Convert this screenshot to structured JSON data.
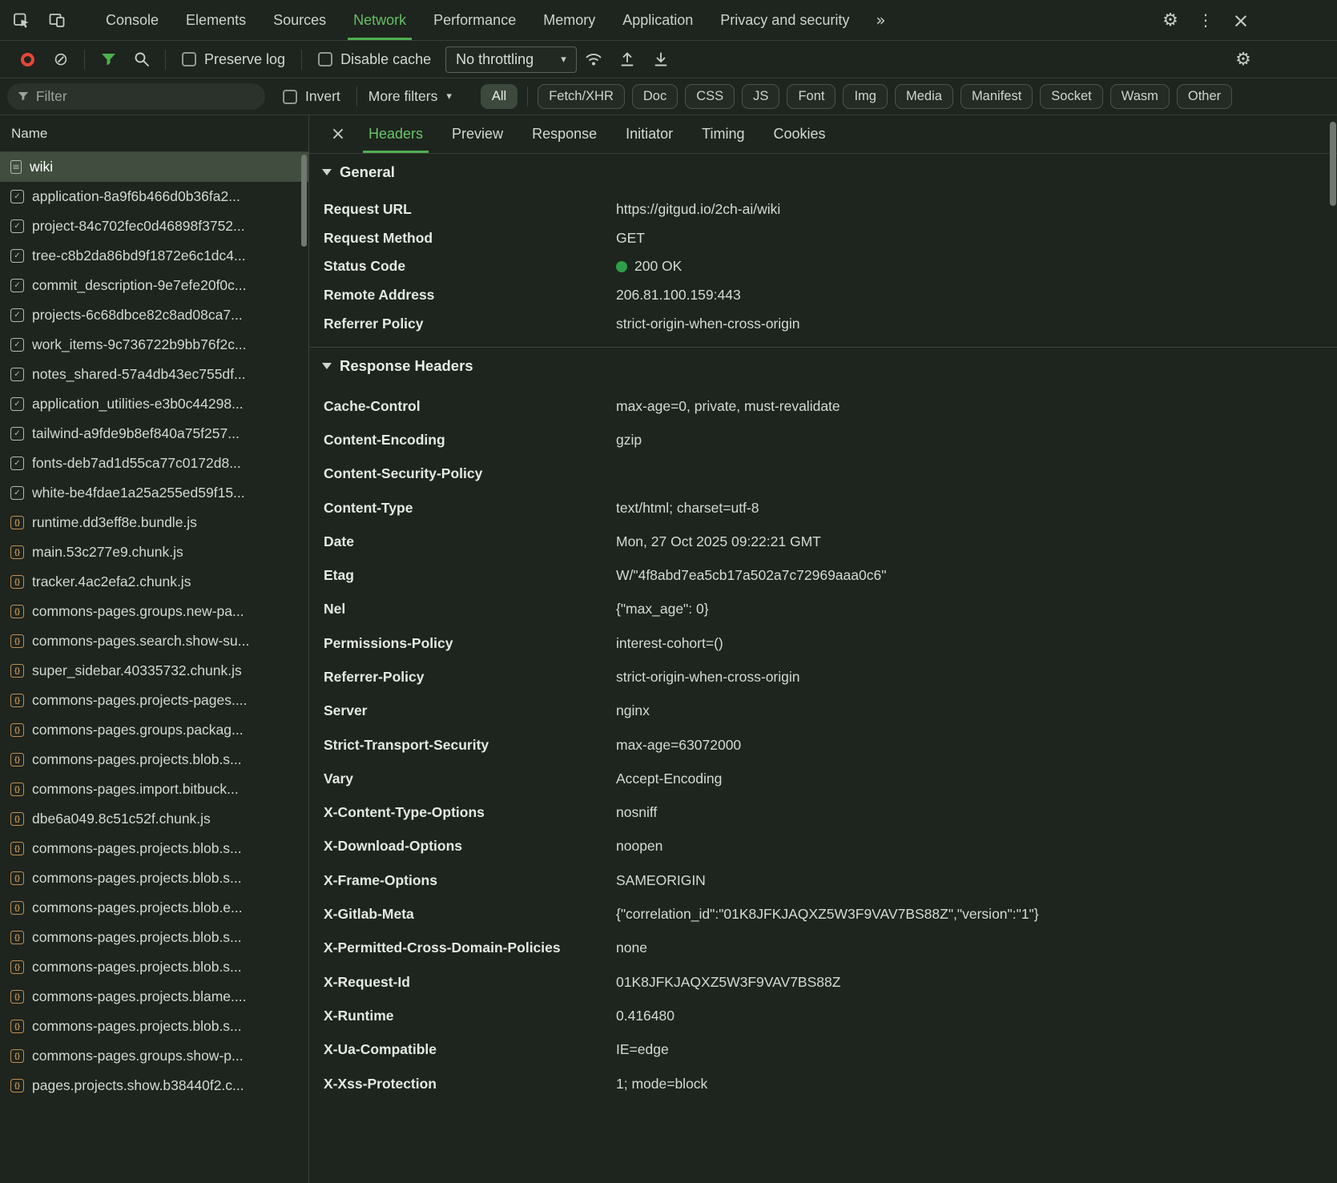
{
  "icons": {
    "more_tabs": "»",
    "gear": "⚙",
    "kebab": "⋮",
    "close": "×",
    "clear": "⊘",
    "caret": "▾"
  },
  "devtools": {
    "tabs": [
      {
        "label": "Console",
        "active": false
      },
      {
        "label": "Elements",
        "active": false
      },
      {
        "label": "Sources",
        "active": false
      },
      {
        "label": "Network",
        "active": true
      },
      {
        "label": "Performance",
        "active": false
      },
      {
        "label": "Memory",
        "active": false
      },
      {
        "label": "Application",
        "active": false
      },
      {
        "label": "Privacy and security",
        "active": false
      }
    ]
  },
  "toolbar": {
    "preserve_log_label": "Preserve log",
    "disable_cache_label": "Disable cache",
    "throttling_value": "No throttling"
  },
  "filter_bar": {
    "filter_placeholder": "Filter",
    "invert_label": "Invert",
    "more_filters_label": "More filters",
    "selected_chip": "All",
    "chips": [
      "All",
      "Fetch/XHR",
      "Doc",
      "CSS",
      "JS",
      "Font",
      "Img",
      "Media",
      "Manifest",
      "Socket",
      "Wasm",
      "Other"
    ]
  },
  "request_list": {
    "column_header": "Name",
    "items": [
      {
        "name": "wiki",
        "type": "doc",
        "selected": true
      },
      {
        "name": "application-8a9f6b466d0b36fa2...",
        "type": "css"
      },
      {
        "name": "project-84c702fec0d46898f3752...",
        "type": "css"
      },
      {
        "name": "tree-c8b2da86bd9f1872e6c1dc4...",
        "type": "css"
      },
      {
        "name": "commit_description-9e7efe20f0c...",
        "type": "css"
      },
      {
        "name": "projects-6c68dbce82c8ad08ca7...",
        "type": "css"
      },
      {
        "name": "work_items-9c736722b9bb76f2c...",
        "type": "css"
      },
      {
        "name": "notes_shared-57a4db43ec755df...",
        "type": "css"
      },
      {
        "name": "application_utilities-e3b0c44298...",
        "type": "css"
      },
      {
        "name": "tailwind-a9fde9b8ef840a75f257...",
        "type": "css"
      },
      {
        "name": "fonts-deb7ad1d55ca77c0172d8...",
        "type": "css"
      },
      {
        "name": "white-be4fdae1a25a255ed59f15...",
        "type": "css"
      },
      {
        "name": "runtime.dd3eff8e.bundle.js",
        "type": "js"
      },
      {
        "name": "main.53c277e9.chunk.js",
        "type": "js"
      },
      {
        "name": "tracker.4ac2efa2.chunk.js",
        "type": "js"
      },
      {
        "name": "commons-pages.groups.new-pa...",
        "type": "js"
      },
      {
        "name": "commons-pages.search.show-su...",
        "type": "js"
      },
      {
        "name": "super_sidebar.40335732.chunk.js",
        "type": "js"
      },
      {
        "name": "commons-pages.projects-pages....",
        "type": "js"
      },
      {
        "name": "commons-pages.groups.packag...",
        "type": "js"
      },
      {
        "name": "commons-pages.projects.blob.s...",
        "type": "js"
      },
      {
        "name": "commons-pages.import.bitbuck...",
        "type": "js"
      },
      {
        "name": "dbe6a049.8c51c52f.chunk.js",
        "type": "js"
      },
      {
        "name": "commons-pages.projects.blob.s...",
        "type": "js"
      },
      {
        "name": "commons-pages.projects.blob.s...",
        "type": "js"
      },
      {
        "name": "commons-pages.projects.blob.e...",
        "type": "js"
      },
      {
        "name": "commons-pages.projects.blob.s...",
        "type": "js"
      },
      {
        "name": "commons-pages.projects.blob.s...",
        "type": "js"
      },
      {
        "name": "commons-pages.projects.blame....",
        "type": "js"
      },
      {
        "name": "commons-pages.projects.blob.s...",
        "type": "js"
      },
      {
        "name": "commons-pages.groups.show-p...",
        "type": "js"
      },
      {
        "name": "pages.projects.show.b38440f2.c...",
        "type": "js"
      }
    ]
  },
  "details": {
    "tabs": [
      "Headers",
      "Preview",
      "Response",
      "Initiator",
      "Timing",
      "Cookies"
    ],
    "active_tab": "Headers",
    "general": {
      "title": "General",
      "rows": [
        {
          "key": "Request URL",
          "value": "https://gitgud.io/2ch-ai/wiki"
        },
        {
          "key": "Request Method",
          "value": "GET"
        },
        {
          "key": "Status Code",
          "value": "200 OK",
          "status_dot": true
        },
        {
          "key": "Remote Address",
          "value": "206.81.100.159:443"
        },
        {
          "key": "Referrer Policy",
          "value": "strict-origin-when-cross-origin"
        }
      ]
    },
    "response_headers": {
      "title": "Response Headers",
      "rows": [
        {
          "key": "Cache-Control",
          "value": "max-age=0, private, must-revalidate"
        },
        {
          "key": "Content-Encoding",
          "value": "gzip"
        },
        {
          "key": "Content-Security-Policy",
          "value": ""
        },
        {
          "key": "Content-Type",
          "value": "text/html; charset=utf-8"
        },
        {
          "key": "Date",
          "value": "Mon, 27 Oct 2025 09:22:21 GMT"
        },
        {
          "key": "Etag",
          "value": "W/\"4f8abd7ea5cb17a502a7c72969aaa0c6\""
        },
        {
          "key": "Nel",
          "value": "{\"max_age\": 0}"
        },
        {
          "key": "Permissions-Policy",
          "value": "interest-cohort=()"
        },
        {
          "key": "Referrer-Policy",
          "value": "strict-origin-when-cross-origin"
        },
        {
          "key": "Server",
          "value": "nginx"
        },
        {
          "key": "Strict-Transport-Security",
          "value": "max-age=63072000"
        },
        {
          "key": "Vary",
          "value": "Accept-Encoding"
        },
        {
          "key": "X-Content-Type-Options",
          "value": "nosniff"
        },
        {
          "key": "X-Download-Options",
          "value": "noopen"
        },
        {
          "key": "X-Frame-Options",
          "value": "SAMEORIGIN"
        },
        {
          "key": "X-Gitlab-Meta",
          "value": "{\"correlation_id\":\"01K8JFKJAQXZ5W3F9VAV7BS88Z\",\"version\":\"1\"}"
        },
        {
          "key": "X-Permitted-Cross-Domain-Policies",
          "value": "none"
        },
        {
          "key": "X-Request-Id",
          "value": "01K8JFKJAQXZ5W3F9VAV7BS88Z"
        },
        {
          "key": "X-Runtime",
          "value": "0.416480"
        },
        {
          "key": "X-Ua-Compatible",
          "value": "IE=edge"
        },
        {
          "key": "X-Xss-Protection",
          "value": "1; mode=block"
        }
      ]
    }
  }
}
